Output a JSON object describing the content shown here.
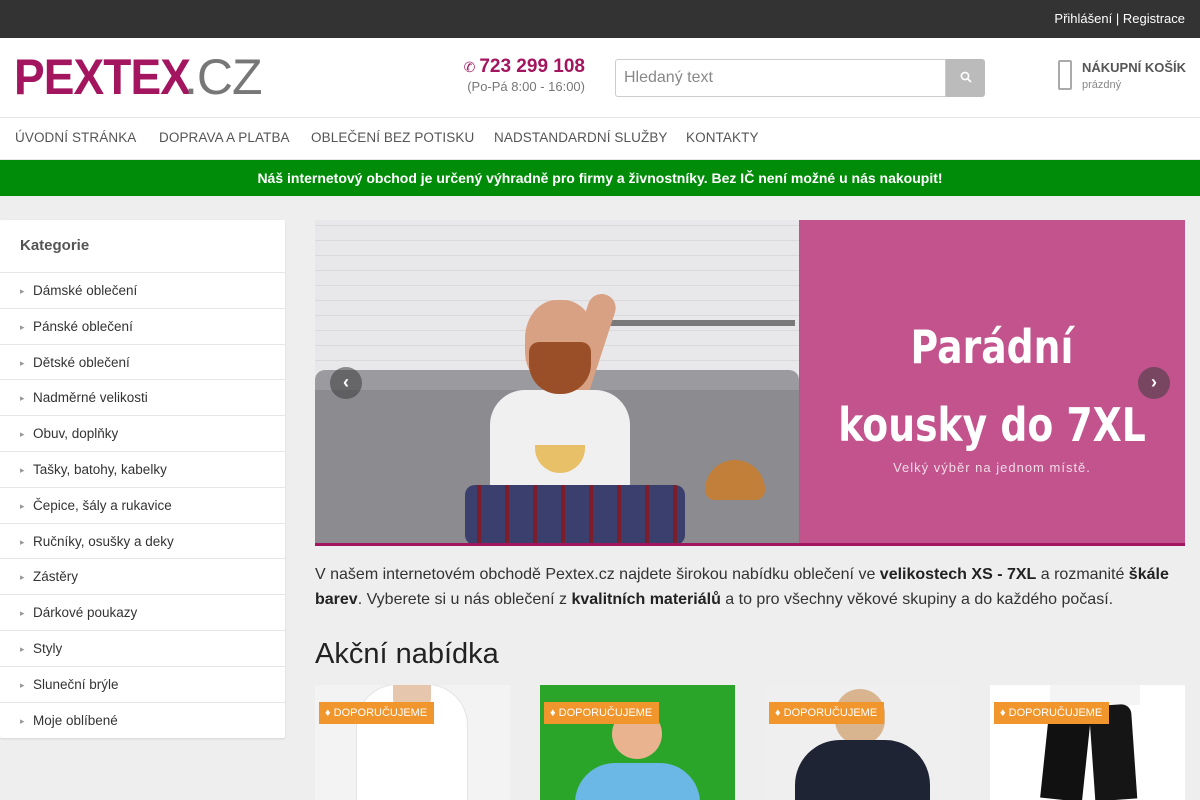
{
  "topbar": {
    "login": "Přihlášení",
    "separator": "|",
    "register": "Registrace"
  },
  "header": {
    "logo_brand": "PEXTEX",
    "logo_tld": ".CZ",
    "phone": "723 299 108",
    "phone_icon": "phone-icon",
    "hours": "(Po-Pá 8:00 - 16:00)",
    "search_placeholder": "Hledaný text",
    "cart_title": "NÁKUPNÍ KOŠÍK",
    "cart_state": "prázdný"
  },
  "nav": [
    "ÚVODNÍ STRÁNKA",
    "DOPRAVA A PLATBA",
    "OBLEČENÍ BEZ POTISKU",
    "NADSTANDARDNÍ SLUŽBY",
    "KONTAKTY"
  ],
  "notice": "Náš internetový obchod je určený výhradně pro firmy a živnostníky. Bez IČ není možné u nás nakoupit!",
  "sidebar": {
    "title": "Kategorie",
    "items": [
      "Dámské oblečení",
      "Pánské oblečení",
      "Dětské oblečení",
      "Nadměrné velikosti",
      "Obuv, doplňky",
      "Tašky, batohy, kabelky",
      "Čepice, šály a rukavice",
      "Ručníky, osušky a deky",
      "Zástěry",
      "Dárkové poukazy",
      "Styly",
      "Sluneční brýle",
      "Moje oblíbené"
    ]
  },
  "slider": {
    "headline_1": "Parádní",
    "headline_2": "kousky do 7XL",
    "subline": "Velký výběr na jednom místě.",
    "prev": "‹",
    "next": "›"
  },
  "intro": {
    "t1": "V našem internetovém obchodě Pextex.cz najdete širokou nabídku oblečení ve ",
    "b1": "velikostech XS - 7XL",
    "t2": " a rozmanité ",
    "b2": "škále barev",
    "t3": ". Vyberete si u nás oblečení z ",
    "b3": "kvalitních materiálů",
    "t4": " a to pro všechny věkové skupiny a do každého počasí."
  },
  "section_title": "Akční nabídka",
  "products": [
    {
      "badge": "DOPORUČUJEME"
    },
    {
      "badge": "DOPORUČUJEME"
    },
    {
      "badge": "DOPORUČUJEME"
    },
    {
      "badge": "DOPORUČUJEME"
    }
  ],
  "colors": {
    "brand": "#a3155f",
    "notice": "#008c08",
    "badge": "#f0962d",
    "promo": "#c2538d"
  }
}
